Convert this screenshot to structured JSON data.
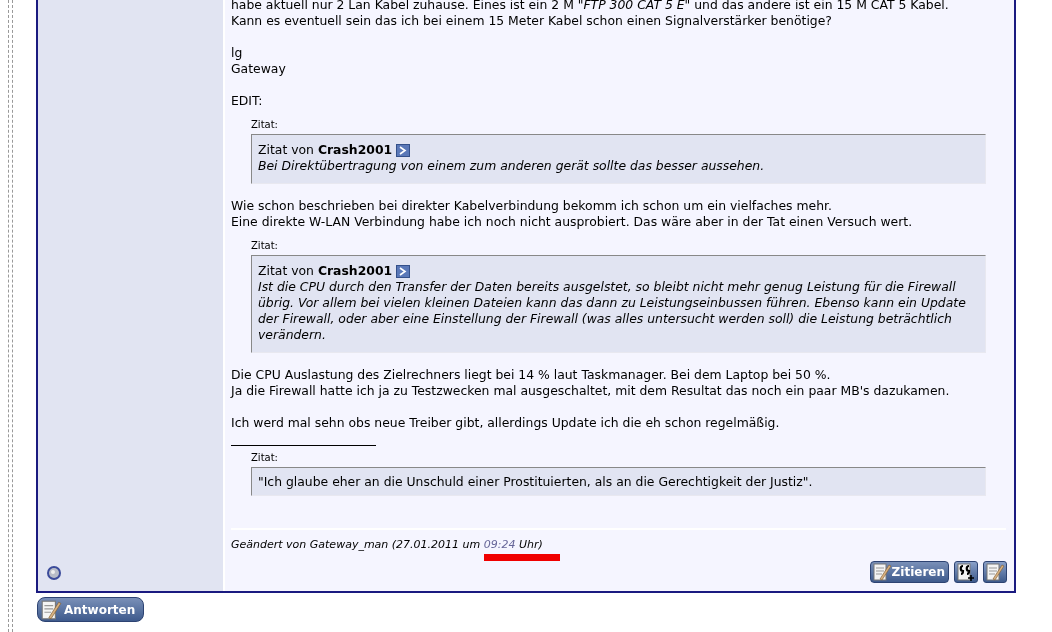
{
  "post": {
    "body": [
      {
        "kind": "text",
        "paragraphs": [
          [
            "habe aktuell nur 2 Lan Kabel zuhause. Eines ist ein 2 M *\"FTP 300 CAT 5 E\"* und das andere ist ein 15 M CAT 5 Kabel.",
            "Kann es eventuell sein das ich bei einem 15 Meter Kabel schon einen Signalverstärker benötige?"
          ],
          [
            "lg",
            "Gateway"
          ],
          [
            "EDIT:"
          ]
        ]
      },
      {
        "kind": "quote",
        "label": "Zitat:",
        "prefix": "Zitat von",
        "author": "Crash2001",
        "text": "Bei Direktübertragung von einem zum anderen gerät sollte das besser aussehen."
      },
      {
        "kind": "text",
        "paragraphs": [
          [
            "Wie schon beschrieben bei direkter Kabelverbindung bekomm ich schon um ein vielfaches mehr.",
            "Eine direkte W-LAN Verbindung habe ich noch nicht ausprobiert. Das wäre aber in der Tat einen Versuch wert."
          ]
        ]
      },
      {
        "kind": "quote",
        "label": "Zitat:",
        "prefix": "Zitat von",
        "author": "Crash2001",
        "text": "Ist die CPU durch den Transfer der Daten bereits ausgelstet, so bleibt nicht mehr genug Leistung für die Firewall übrig. Vor allem bei vielen kleinen Dateien kann das dann zu Leistungseinbussen führen. Ebenso kann ein Update der Firewall, oder aber eine Einstellung der Firewall (was alles untersucht werden soll) die Leistung beträchtlich verändern."
      },
      {
        "kind": "text",
        "paragraphs": [
          [
            "Die CPU Auslastung des Zielrechners liegt bei 14 % laut Taskmanager. Bei dem Laptop bei 50 %.",
            "Ja die Firewall hatte ich ja zu Testzwecken mal ausgeschaltet, mit dem Resultat das noch ein paar MB's dazukamen."
          ],
          [
            "Ich werd mal sehn obs neue Treiber gibt, allerdings Update ich die eh schon regelmäßig."
          ]
        ]
      }
    ],
    "signature": {
      "label": "Zitat:",
      "text": "\"Ich glaube eher an die Unschuld einer Prostituierten, als an die Gerechtigkeit der Justiz\"."
    },
    "edit_note": {
      "before": "Geändert von Gateway_man (27.01.2011 um ",
      "time": "09:24",
      "after": " Uhr)"
    },
    "buttons": [
      {
        "kind": "quote",
        "label": "Zitieren"
      },
      {
        "kind": "multiquote"
      },
      {
        "kind": "edit"
      }
    ]
  },
  "reply_button": {
    "label": "Antworten"
  }
}
